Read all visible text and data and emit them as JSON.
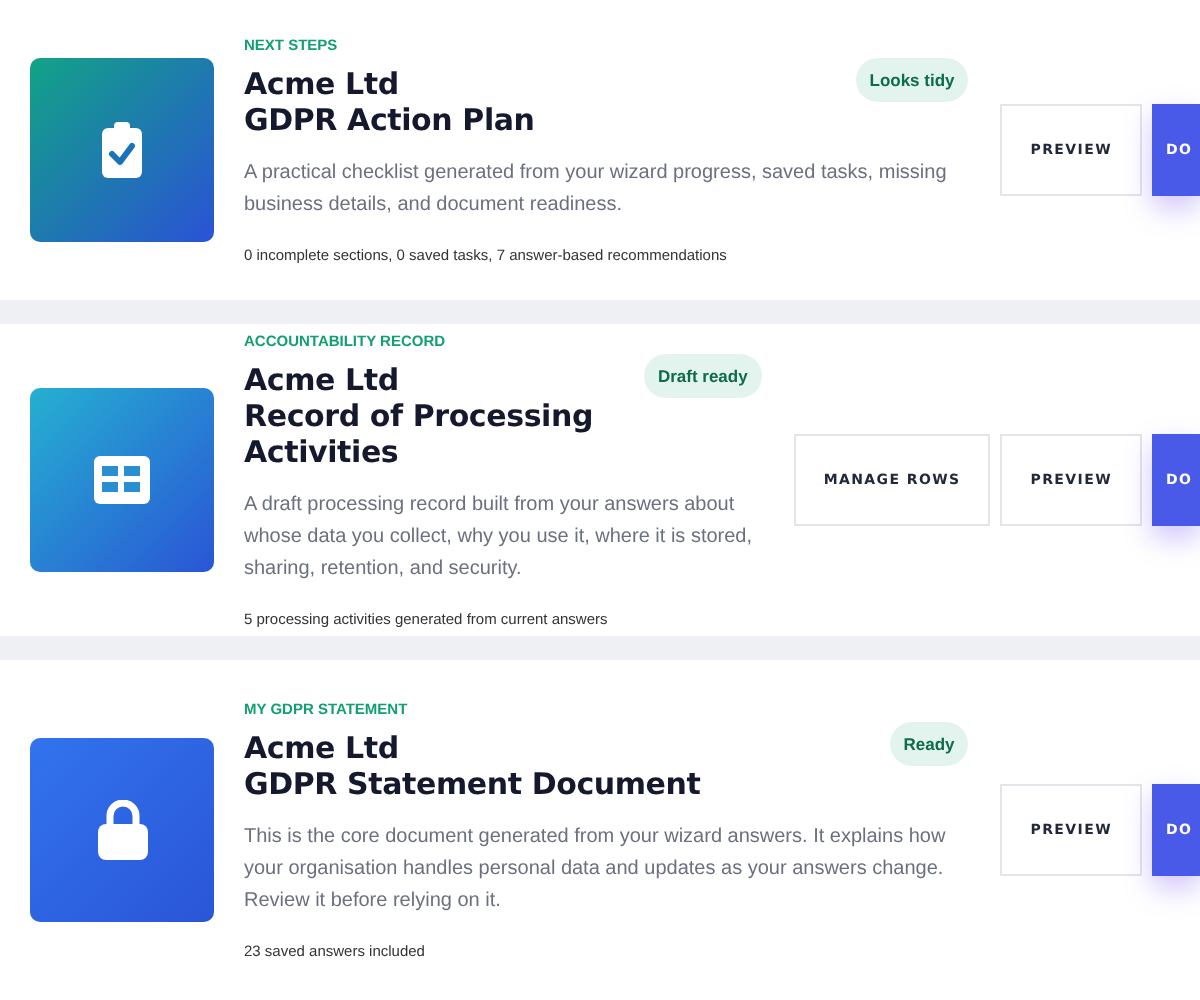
{
  "cards": [
    {
      "kind": "checklist",
      "eyebrow": "NEXT STEPS",
      "company": "Acme Ltd",
      "title": "GDPR Action Plan",
      "badge": "Looks tidy",
      "description": "A practical checklist generated from your wizard progress, saved tasks, missing business details, and document readiness.",
      "meta": "0 incomplete sections, 0 saved tasks, 7 answer-based recommendations",
      "buttons": [
        {
          "kind": "outline",
          "label": "PREVIEW"
        },
        {
          "kind": "primary",
          "label": "DO"
        }
      ]
    },
    {
      "kind": "table",
      "eyebrow": "ACCOUNTABILITY RECORD",
      "company": "Acme Ltd",
      "title": "Record of Processing Activities",
      "badge": "Draft ready",
      "description": "A draft processing record built from your answers about whose data you collect, why you use it, where it is stored, sharing, retention, and security.",
      "meta": "5 processing activities generated from current answers",
      "buttons": [
        {
          "kind": "outline",
          "label": "MANAGE ROWS"
        },
        {
          "kind": "outline",
          "label": "PREVIEW"
        },
        {
          "kind": "primary",
          "label": "DO"
        }
      ]
    },
    {
      "kind": "lock",
      "eyebrow": "MY GDPR STATEMENT",
      "company": "Acme Ltd",
      "title": "GDPR Statement Document",
      "badge": "Ready",
      "description": "This is the core document generated from your wizard answers. It explains how your organisation handles personal data and updates as your answers change. Review it before relying on it.",
      "meta": "23 saved answers included",
      "buttons": [
        {
          "kind": "outline",
          "label": "PREVIEW"
        },
        {
          "kind": "primary",
          "label": "DO"
        }
      ]
    }
  ]
}
